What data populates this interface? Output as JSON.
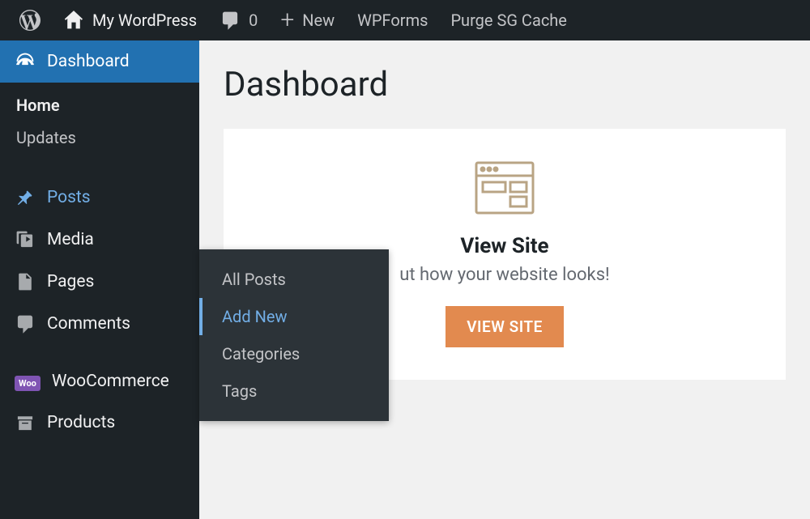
{
  "adminbar": {
    "site_name": "My WordPress",
    "comment_count": "0",
    "new_label": "New",
    "wpforms_label": "WPForms",
    "purge_label": "Purge SG Cache"
  },
  "sidebar": {
    "dashboard": "Dashboard",
    "home": "Home",
    "updates": "Updates",
    "posts": "Posts",
    "media": "Media",
    "pages": "Pages",
    "comments": "Comments",
    "woocommerce": "WooCommerce",
    "products": "Products"
  },
  "flyout": {
    "all_posts": "All Posts",
    "add_new": "Add New",
    "categories": "Categories",
    "tags": "Tags"
  },
  "content": {
    "page_title": "Dashboard",
    "card_title": "View Site",
    "card_text": "ut how your website looks!",
    "card_button": "VIEW SITE"
  }
}
